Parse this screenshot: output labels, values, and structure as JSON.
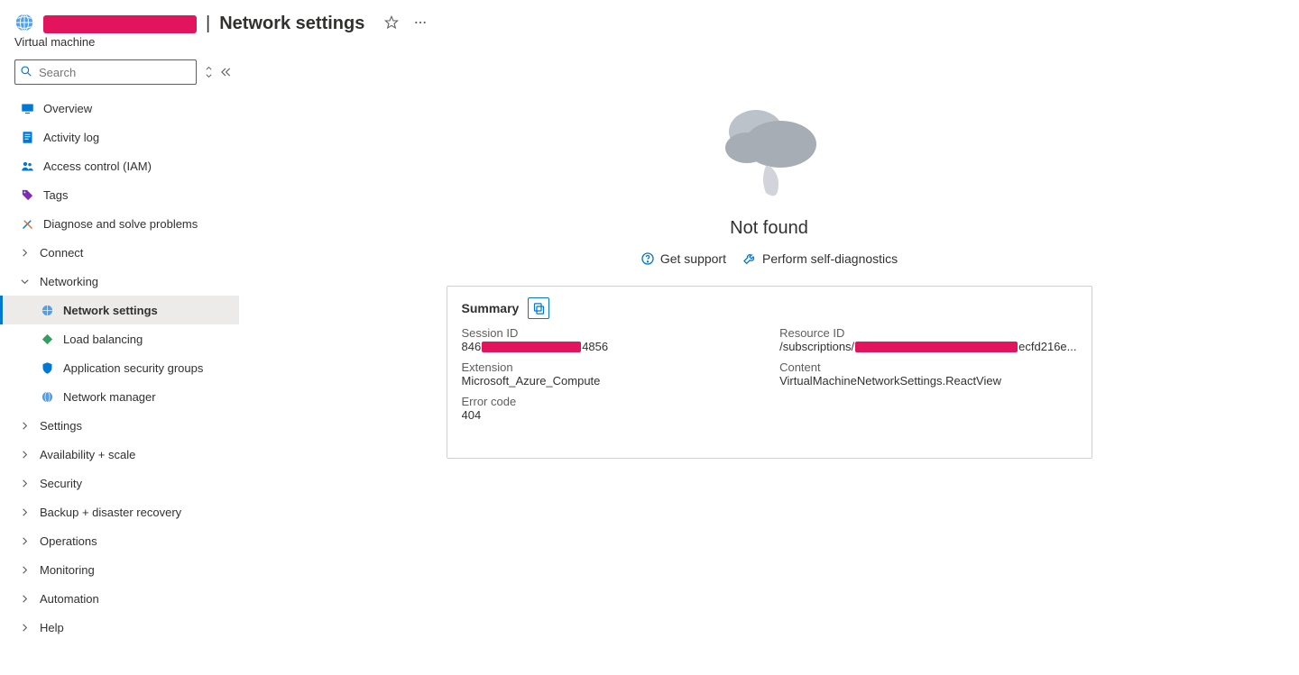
{
  "header": {
    "title_suffix": "Network settings",
    "separator": "|",
    "subtitle": "Virtual machine"
  },
  "sidebar": {
    "search_placeholder": "Search",
    "items": {
      "overview": "Overview",
      "activity_log": "Activity log",
      "iam": "Access control (IAM)",
      "tags": "Tags",
      "diagnose": "Diagnose and solve problems",
      "connect": "Connect",
      "networking": "Networking",
      "network_settings": "Network settings",
      "load_balancing": "Load balancing",
      "asg": "Application security groups",
      "network_manager": "Network manager",
      "settings": "Settings",
      "availability": "Availability + scale",
      "security": "Security",
      "backup": "Backup + disaster recovery",
      "operations": "Operations",
      "monitoring": "Monitoring",
      "automation": "Automation",
      "help": "Help"
    }
  },
  "main": {
    "notfound": "Not found",
    "get_support": "Get support",
    "self_diag": "Perform self-diagnostics",
    "summary_title": "Summary",
    "fields": {
      "session_id": {
        "label": "Session ID",
        "value_prefix": "846",
        "value_suffix": "4856"
      },
      "resource_id": {
        "label": "Resource ID",
        "value_prefix": "/subscriptions/",
        "value_suffix": "ecfd216e..."
      },
      "extension": {
        "label": "Extension",
        "value": "Microsoft_Azure_Compute"
      },
      "content": {
        "label": "Content",
        "value": "VirtualMachineNetworkSettings.ReactView"
      },
      "error_code": {
        "label": "Error code",
        "value": "404"
      }
    }
  }
}
